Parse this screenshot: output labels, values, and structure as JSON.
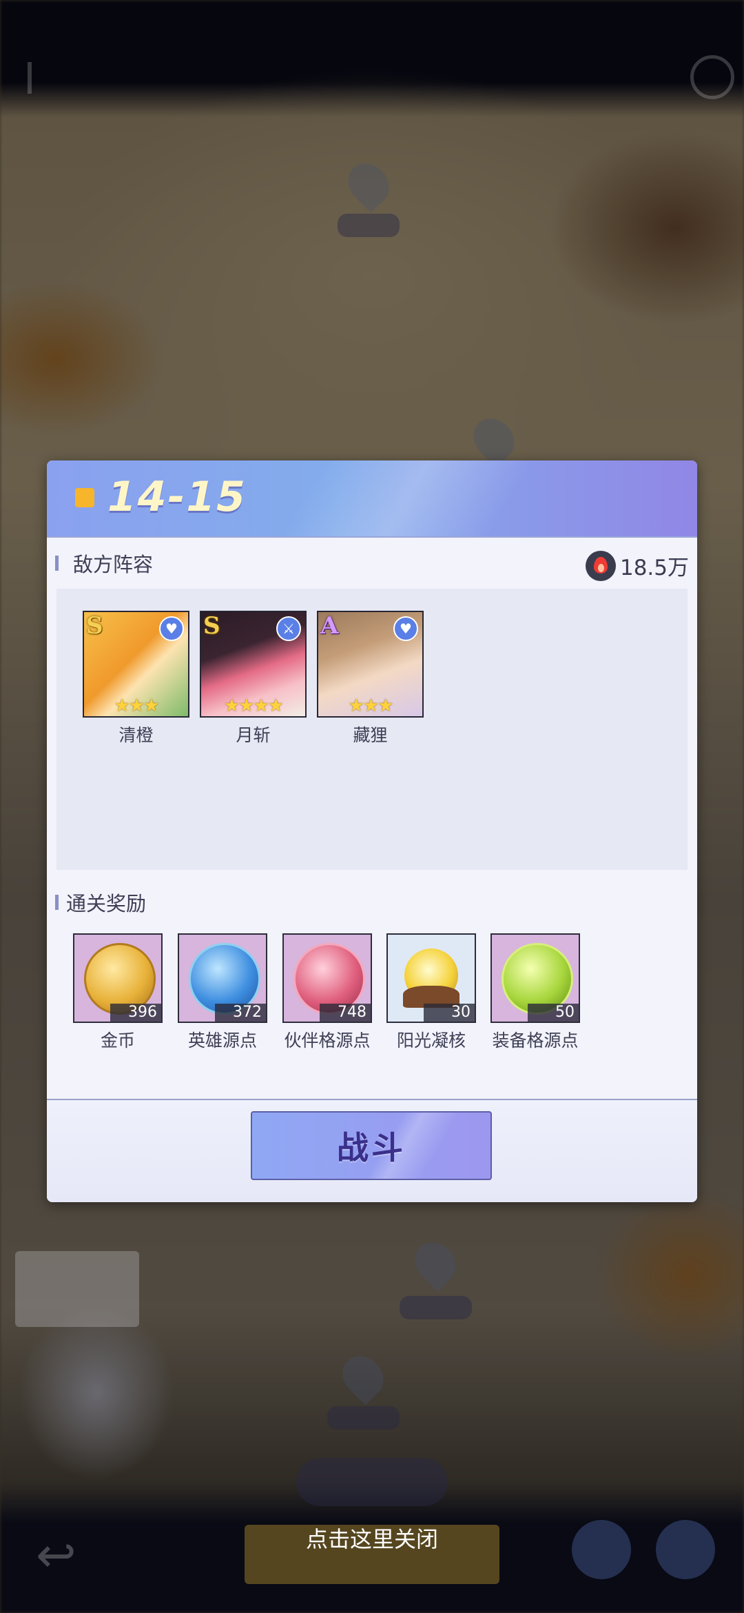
{
  "stage": {
    "level": "14-15"
  },
  "enemy": {
    "section_title": "敌方阵容",
    "power": "18.5万",
    "heroes": [
      {
        "name": "清橙",
        "rank": "S",
        "stars": "★★★",
        "badge_icon": "heart-icon"
      },
      {
        "name": "月斩",
        "rank": "S",
        "stars": "★★★★",
        "badge_icon": "sword-icon"
      },
      {
        "name": "藏狸",
        "rank": "A",
        "stars": "★★★",
        "badge_icon": "heart-icon"
      }
    ]
  },
  "rewards": {
    "section_title": "通关奖励",
    "items": [
      {
        "name": "金币",
        "count": "396",
        "icon": "gold-coin-icon",
        "color": "#e8b23a"
      },
      {
        "name": "英雄源点",
        "count": "372",
        "icon": "blue-helmet-orb-icon",
        "color": "#3f8fe0"
      },
      {
        "name": "伙伴格源点",
        "count": "748",
        "icon": "pink-orb-icon",
        "color": "#e0607e"
      },
      {
        "name": "阳光凝核",
        "count": "30",
        "icon": "sun-crystal-icon",
        "color": "#f5d23a"
      },
      {
        "name": "装备格源点",
        "count": "50",
        "icon": "green-sword-orb-icon",
        "color": "#a7d63c"
      }
    ]
  },
  "actions": {
    "fight_label": "战斗",
    "close_hint": "点击这里关闭"
  },
  "colors": {
    "accent": "#8aa1ef",
    "button_text": "#3a2f8a",
    "gold": "#f6b52a"
  }
}
